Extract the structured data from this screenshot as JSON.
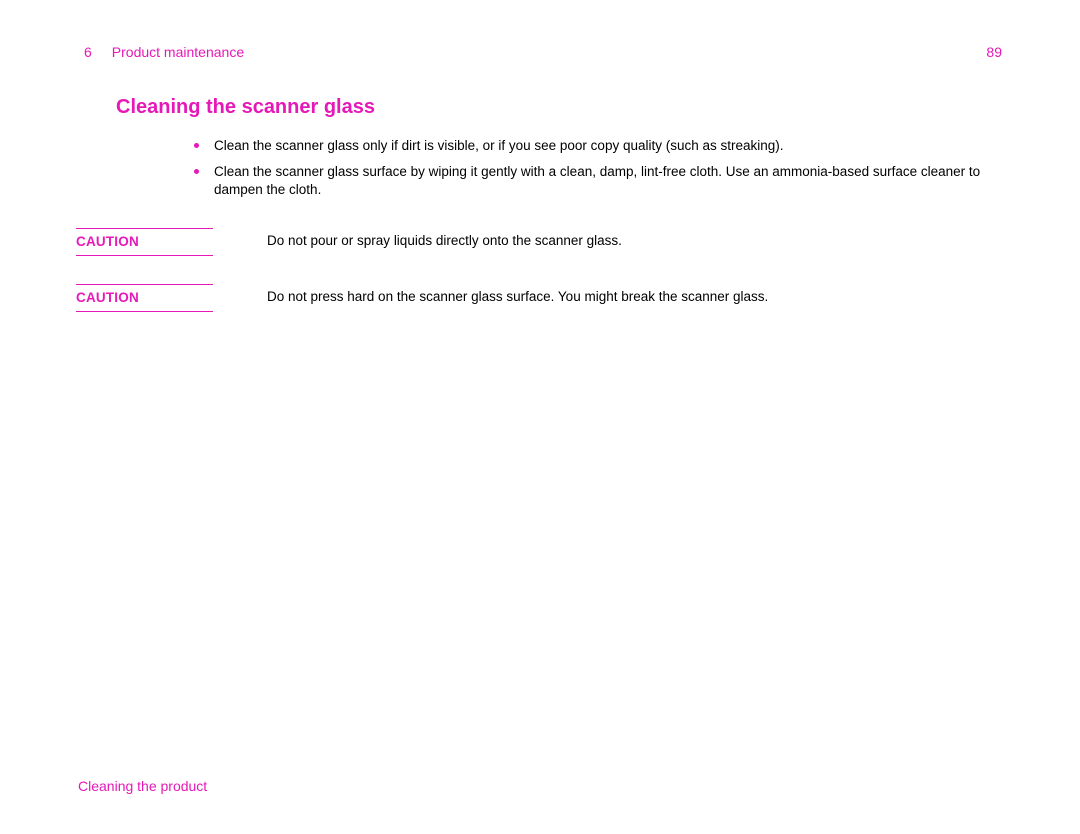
{
  "header": {
    "chapter_number": "6",
    "chapter_title": "Product maintenance",
    "page_number": "89"
  },
  "section": {
    "heading": "Cleaning the scanner glass",
    "bullets": [
      "Clean the scanner glass only if dirt is visible, or if you see poor copy quality (such as streaking).",
      "Clean the scanner glass surface by wiping it gently with a clean, damp, lint-free cloth. Use an ammonia-based surface cleaner to dampen the cloth."
    ],
    "cautions": [
      {
        "label": "CAUTION",
        "text": "Do not pour or spray liquids directly onto the scanner glass."
      },
      {
        "label": "CAUTION",
        "text": "Do not press hard on the scanner glass surface. You might break the scanner glass."
      }
    ]
  },
  "footer": {
    "text": "Cleaning the product"
  }
}
